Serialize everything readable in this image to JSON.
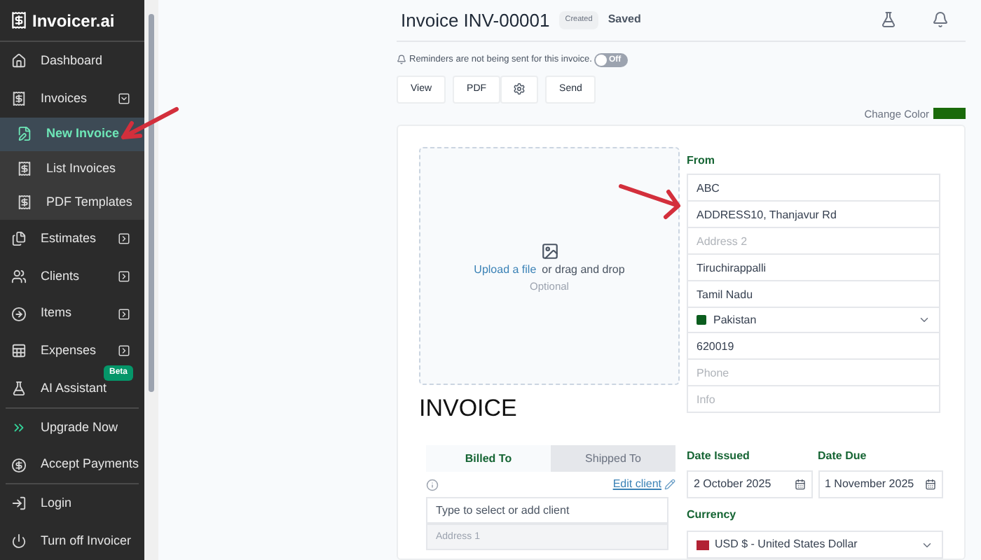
{
  "sidebar": {
    "logo": "Invoicer.ai",
    "items": [
      {
        "label": "Dashboard",
        "selected": false
      },
      {
        "label": "Invoices",
        "selected": false,
        "expanded": true,
        "children": [
          {
            "label": "New Invoice",
            "selected": true
          },
          {
            "label": "List Invoices",
            "selected": false
          },
          {
            "label": "PDF Templates",
            "selected": false
          }
        ]
      },
      {
        "label": "Estimates",
        "selected": false,
        "expanded": false
      },
      {
        "label": "Clients",
        "selected": false,
        "expanded": false
      },
      {
        "label": "Items",
        "selected": false,
        "expanded": false
      },
      {
        "label": "Expenses",
        "selected": false,
        "expanded": false
      },
      {
        "label": "AI Assistant",
        "selected": false,
        "badge": "Beta"
      },
      {
        "label": "Upgrade Now",
        "selected": false,
        "divider_before": true
      },
      {
        "label": "Accept Payments",
        "selected": false
      },
      {
        "label": "Login",
        "selected": false,
        "divider_before": true
      },
      {
        "label": "Turn off Invoicer",
        "selected": false
      }
    ]
  },
  "header": {
    "title": "Invoice INV-00001",
    "status_badge": "Created",
    "save_state": "Saved"
  },
  "reminder": {
    "text": "Reminders are not being sent for this invoice.",
    "toggle_label": "Off",
    "on": false
  },
  "toolbar": [
    "View",
    "PDF",
    "Send"
  ],
  "change_color": {
    "label": "Change Color",
    "color": "#1a6a0a"
  },
  "upload": {
    "link": "Upload a file",
    "text": "or drag and drop",
    "hint": "Optional"
  },
  "doc_title": "INVOICE",
  "from": {
    "label": "From",
    "fields": [
      {
        "kind": "text",
        "value": "ABC"
      },
      {
        "kind": "text",
        "value": "ADDRESS10, Thanjavur Rd"
      },
      {
        "kind": "text",
        "placeholder": "Address 2"
      },
      {
        "kind": "text",
        "value": "Tiruchirappalli"
      },
      {
        "kind": "text",
        "value": "Tamil Nadu"
      },
      {
        "kind": "select",
        "value": "Pakistan"
      },
      {
        "kind": "text",
        "value": "620019"
      },
      {
        "kind": "text",
        "placeholder": "Phone"
      },
      {
        "kind": "text",
        "placeholder": "Info"
      }
    ]
  },
  "client_tabs": [
    {
      "label": "Billed To",
      "selected": true
    },
    {
      "label": "Shipped To",
      "selected": false
    }
  ],
  "edit_client": "Edit client",
  "client_field": {
    "placeholder": "Type to select or add client"
  },
  "address_field": {
    "placeholder": "Address 1"
  },
  "date_issued": {
    "label": "Date Issued",
    "value": "2 October 2025"
  },
  "date_due": {
    "label": "Date Due",
    "value": "1 November 2025"
  },
  "currency": {
    "label": "Currency",
    "value": "USD $ - United States Dollar"
  }
}
